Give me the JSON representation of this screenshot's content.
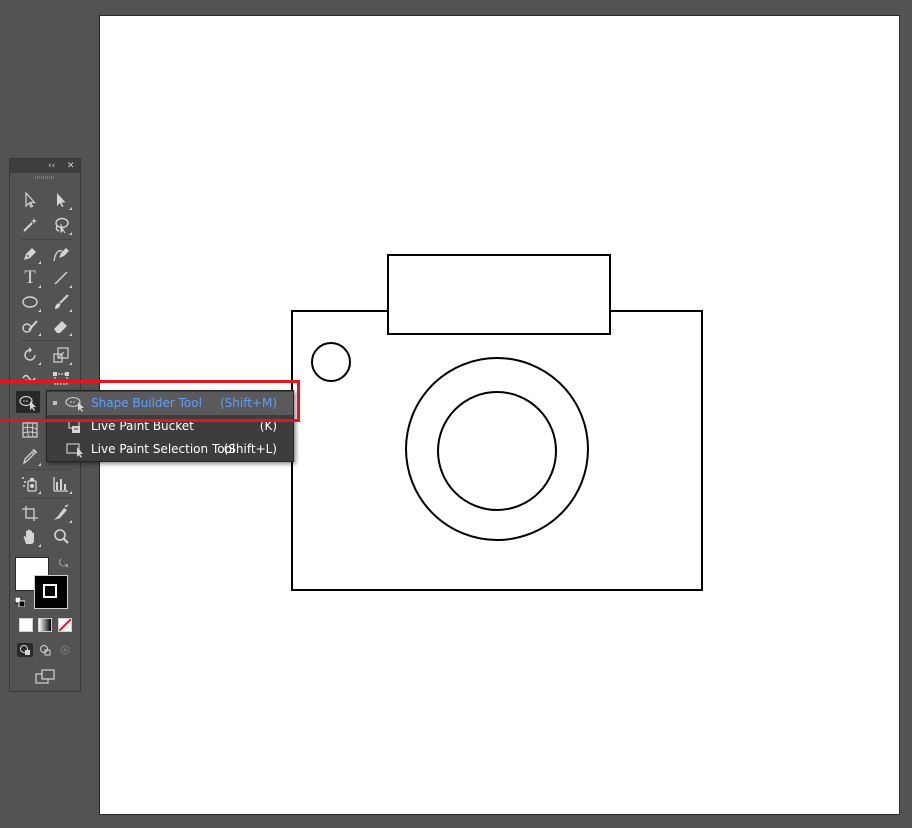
{
  "toolbox": {
    "collapse_glyph": "‹‹",
    "close_glyph": "✕",
    "tools": [
      {
        "name": "selection-tool",
        "icon": "arrow-hollow-icon"
      },
      {
        "name": "direct-selection-tool",
        "icon": "arrow-solid-icon"
      },
      {
        "name": "magic-wand-tool",
        "icon": "magic-wand-icon"
      },
      {
        "name": "lasso-tool",
        "icon": "lasso-icon"
      },
      {
        "name": "pen-tool",
        "icon": "pen-icon"
      },
      {
        "name": "curvature-tool",
        "icon": "curvature-pen-icon"
      },
      {
        "name": "type-tool",
        "icon": "type-icon",
        "glyph": "T"
      },
      {
        "name": "line-segment-tool",
        "icon": "line-icon"
      },
      {
        "name": "ellipse-tool",
        "icon": "ellipse-icon"
      },
      {
        "name": "paintbrush-tool",
        "icon": "brush-icon"
      },
      {
        "name": "shaper-tool",
        "icon": "shaper-icon"
      },
      {
        "name": "eraser-tool",
        "icon": "eraser-icon"
      },
      {
        "name": "rotate-tool",
        "icon": "rotate-icon"
      },
      {
        "name": "scale-tool",
        "icon": "scale-icon"
      },
      {
        "name": "warp-tool",
        "icon": "warp-icon"
      },
      {
        "name": "free-transform-tool",
        "icon": "free-transform-icon"
      },
      {
        "name": "shape-builder-tool",
        "icon": "shape-builder-icon"
      },
      {
        "name": "mesh-tool",
        "icon": "mesh-icon"
      },
      {
        "name": "eyedropper-tool",
        "icon": "eyedropper-icon"
      },
      {
        "name": "symbol-sprayer-tool",
        "icon": "symbol-sprayer-icon"
      },
      {
        "name": "column-graph-tool",
        "icon": "column-graph-icon"
      },
      {
        "name": "artboard-tool",
        "icon": "artboard-icon"
      },
      {
        "name": "slice-tool",
        "icon": "slice-icon"
      },
      {
        "name": "hand-tool",
        "icon": "hand-icon"
      },
      {
        "name": "zoom-tool",
        "icon": "zoom-icon"
      }
    ],
    "fill_color": "#ffffff",
    "stroke_color": "#000000"
  },
  "flyout": {
    "items": [
      {
        "label": "Shape Builder Tool",
        "shortcut": "(Shift+M)",
        "selected": true,
        "icon": "shape-builder-icon"
      },
      {
        "label": "Live Paint Bucket",
        "shortcut": "(K)",
        "selected": false,
        "icon": "live-paint-bucket-icon"
      },
      {
        "label": "Live Paint Selection Tool",
        "shortcut": "(Shift+L)",
        "selected": false,
        "icon": "live-paint-selection-icon"
      }
    ]
  },
  "highlight_color": "#e8141c",
  "selected_text_color": "#5aa0ff"
}
